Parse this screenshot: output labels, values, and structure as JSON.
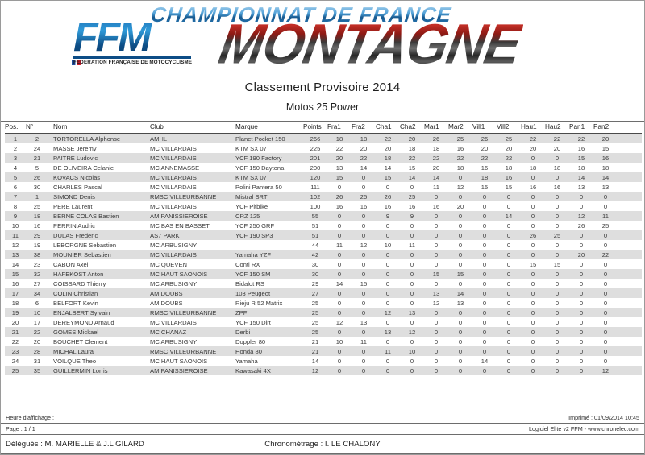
{
  "masthead": {
    "championship_text": "CHAMPIONNAT DE FRANCE",
    "event_text": "MONTAGNE",
    "federation_logo_letters": "FFM",
    "federation_name": "FEDERATION FRANÇAISE DE MOTOCYCLISME",
    "colors": {
      "ffm_blue": "#0d4d86",
      "montagne_red": "#a81c16",
      "montagne_dark": "#262626",
      "champ_blue": "#2f86c4"
    }
  },
  "document": {
    "title": "Classement Provisoire 2014",
    "subtitle": "Motos 25 Power"
  },
  "table": {
    "columns": [
      "Pos.",
      "N°",
      "Nom",
      "Club",
      "Marque",
      "Points",
      "Fra1",
      "Fra2",
      "Cha1",
      "Cha2",
      "Mar1",
      "Mar2",
      "Vill1",
      "Vill2",
      "Hau1",
      "Hau2",
      "Pan1",
      "Pan2"
    ],
    "rows": [
      {
        "pos": "1",
        "num": "2",
        "nom": "TORTORELLA Alphonse",
        "club": "AMHL",
        "marque": "Planet Pocket 150",
        "points": "266",
        "legs": [
          "18",
          "18",
          "22",
          "20",
          "26",
          "25",
          "26",
          "25",
          "22",
          "22",
          "22",
          "20"
        ]
      },
      {
        "pos": "2",
        "num": "24",
        "nom": "MASSE Jeremy",
        "club": "MC VILLARDAIS",
        "marque": "KTM SX 07",
        "points": "225",
        "legs": [
          "22",
          "20",
          "20",
          "18",
          "18",
          "16",
          "20",
          "20",
          "20",
          "20",
          "16",
          "15"
        ]
      },
      {
        "pos": "3",
        "num": "21",
        "nom": "PAITRE Ludovic",
        "club": "MC VILLARDAIS",
        "marque": "YCF 190 Factory",
        "points": "201",
        "legs": [
          "20",
          "22",
          "18",
          "22",
          "22",
          "22",
          "22",
          "22",
          "0",
          "0",
          "15",
          "16"
        ]
      },
      {
        "pos": "4",
        "num": "5",
        "nom": "DE OLIVEIRA Celanie",
        "club": "MC ANNEMASSE",
        "marque": "YCF 150 Daytona",
        "points": "200",
        "legs": [
          "13",
          "14",
          "14",
          "15",
          "20",
          "18",
          "16",
          "18",
          "18",
          "18",
          "18",
          "18"
        ]
      },
      {
        "pos": "5",
        "num": "26",
        "nom": "KOVACS Nicolas",
        "club": "MC VILLARDAIS",
        "marque": "KTM SX 07",
        "points": "120",
        "legs": [
          "15",
          "0",
          "15",
          "14",
          "14",
          "0",
          "18",
          "16",
          "0",
          "0",
          "14",
          "14"
        ]
      },
      {
        "pos": "6",
        "num": "30",
        "nom": "CHARLES Pascal",
        "club": "MC VILLARDAIS",
        "marque": "Polini Pantera 50",
        "points": "111",
        "legs": [
          "0",
          "0",
          "0",
          "0",
          "11",
          "12",
          "15",
          "15",
          "16",
          "16",
          "13",
          "13"
        ]
      },
      {
        "pos": "7",
        "num": "1",
        "nom": "SIMOND Denis",
        "club": "RMSC VILLEURBANNE",
        "marque": "Mistral SRT",
        "points": "102",
        "legs": [
          "26",
          "25",
          "26",
          "25",
          "0",
          "0",
          "0",
          "0",
          "0",
          "0",
          "0",
          "0"
        ]
      },
      {
        "pos": "8",
        "num": "25",
        "nom": "PERE Laurent",
        "club": "MC VILLARDAIS",
        "marque": "YCF Pitbike",
        "points": "100",
        "legs": [
          "16",
          "16",
          "16",
          "16",
          "16",
          "20",
          "0",
          "0",
          "0",
          "0",
          "0",
          "0"
        ]
      },
      {
        "pos": "9",
        "num": "18",
        "nom": "BERNE COLAS Bastien",
        "club": "AM PANISSIEROISE",
        "marque": "CRZ 125",
        "points": "55",
        "legs": [
          "0",
          "0",
          "9",
          "9",
          "0",
          "0",
          "0",
          "14",
          "0",
          "0",
          "12",
          "11"
        ]
      },
      {
        "pos": "10",
        "num": "16",
        "nom": "PERRIN Audric",
        "club": "MC BAS EN BASSET",
        "marque": "YCF 250 GRF",
        "points": "51",
        "legs": [
          "0",
          "0",
          "0",
          "0",
          "0",
          "0",
          "0",
          "0",
          "0",
          "0",
          "26",
          "25"
        ]
      },
      {
        "pos": "11",
        "num": "29",
        "nom": "DULAS Frederic",
        "club": "AS7 PARK",
        "marque": "YCF 190 SP3",
        "points": "51",
        "legs": [
          "0",
          "0",
          "0",
          "0",
          "0",
          "0",
          "0",
          "0",
          "26",
          "25",
          "0",
          "0"
        ]
      },
      {
        "pos": "12",
        "num": "19",
        "nom": "LEBORGNE Sebastien",
        "club": "MC ARBUSIGNY",
        "marque": "",
        "points": "44",
        "legs": [
          "11",
          "12",
          "10",
          "11",
          "0",
          "0",
          "0",
          "0",
          "0",
          "0",
          "0",
          "0"
        ]
      },
      {
        "pos": "13",
        "num": "38",
        "nom": "MOUNIER Sebastien",
        "club": "MC VILLARDAIS",
        "marque": "Yamaha YZF",
        "points": "42",
        "legs": [
          "0",
          "0",
          "0",
          "0",
          "0",
          "0",
          "0",
          "0",
          "0",
          "0",
          "20",
          "22"
        ]
      },
      {
        "pos": "14",
        "num": "23",
        "nom": "CABON Axel",
        "club": "MC QUEVEN",
        "marque": "Conti RX",
        "points": "30",
        "legs": [
          "0",
          "0",
          "0",
          "0",
          "0",
          "0",
          "0",
          "0",
          "15",
          "15",
          "0",
          "0"
        ]
      },
      {
        "pos": "15",
        "num": "32",
        "nom": "HAFEKOST Anton",
        "club": "MC HAUT SAONOIS",
        "marque": "YCF 150 SM",
        "points": "30",
        "legs": [
          "0",
          "0",
          "0",
          "0",
          "15",
          "15",
          "0",
          "0",
          "0",
          "0",
          "0",
          "0"
        ]
      },
      {
        "pos": "16",
        "num": "27",
        "nom": "COISSARD Thierry",
        "club": "MC ARBUSIGNY",
        "marque": "Bidalot RS",
        "points": "29",
        "legs": [
          "14",
          "15",
          "0",
          "0",
          "0",
          "0",
          "0",
          "0",
          "0",
          "0",
          "0",
          "0"
        ]
      },
      {
        "pos": "17",
        "num": "34",
        "nom": "COLIN Christian",
        "club": "AM DOUBS",
        "marque": "103 Peugeot",
        "points": "27",
        "legs": [
          "0",
          "0",
          "0",
          "0",
          "13",
          "14",
          "0",
          "0",
          "0",
          "0",
          "0",
          "0"
        ]
      },
      {
        "pos": "18",
        "num": "6",
        "nom": "BELFORT Kevin",
        "club": "AM DOUBS",
        "marque": "Rieju R 52 Matrix",
        "points": "25",
        "legs": [
          "0",
          "0",
          "0",
          "0",
          "12",
          "13",
          "0",
          "0",
          "0",
          "0",
          "0",
          "0"
        ]
      },
      {
        "pos": "19",
        "num": "10",
        "nom": "ENJALBERT Sylvain",
        "club": "RMSC VILLEURBANNE",
        "marque": "ZPF",
        "points": "25",
        "legs": [
          "0",
          "0",
          "12",
          "13",
          "0",
          "0",
          "0",
          "0",
          "0",
          "0",
          "0",
          "0"
        ]
      },
      {
        "pos": "20",
        "num": "17",
        "nom": "DEREYMOND Arnaud",
        "club": "MC VILLARDAIS",
        "marque": "YCF 150 Dirt",
        "points": "25",
        "legs": [
          "12",
          "13",
          "0",
          "0",
          "0",
          "0",
          "0",
          "0",
          "0",
          "0",
          "0",
          "0"
        ]
      },
      {
        "pos": "21",
        "num": "22",
        "nom": "GOMES Mickael",
        "club": "MC CHANAZ",
        "marque": "Derbi",
        "points": "25",
        "legs": [
          "0",
          "0",
          "13",
          "12",
          "0",
          "0",
          "0",
          "0",
          "0",
          "0",
          "0",
          "0"
        ]
      },
      {
        "pos": "22",
        "num": "20",
        "nom": "BOUCHET Clement",
        "club": "MC ARBUSIGNY",
        "marque": "Doppler 80",
        "points": "21",
        "legs": [
          "10",
          "11",
          "0",
          "0",
          "0",
          "0",
          "0",
          "0",
          "0",
          "0",
          "0",
          "0"
        ]
      },
      {
        "pos": "23",
        "num": "28",
        "nom": "MICHAL Laura",
        "club": "RMSC VILLEURBANNE",
        "marque": "Honda 80",
        "points": "21",
        "legs": [
          "0",
          "0",
          "11",
          "10",
          "0",
          "0",
          "0",
          "0",
          "0",
          "0",
          "0",
          "0"
        ]
      },
      {
        "pos": "24",
        "num": "31",
        "nom": "VOILQUE Theo",
        "club": "MC HAUT SAONOIS",
        "marque": "Yamaha",
        "points": "14",
        "legs": [
          "0",
          "0",
          "0",
          "0",
          "0",
          "0",
          "14",
          "0",
          "0",
          "0",
          "0",
          "0"
        ]
      },
      {
        "pos": "25",
        "num": "35",
        "nom": "GUILLERMIN Lorris",
        "club": "AM PANISSIEROISE",
        "marque": "Kawasaki 4X",
        "points": "12",
        "legs": [
          "0",
          "0",
          "0",
          "0",
          "0",
          "0",
          "0",
          "0",
          "0",
          "0",
          "0",
          "12"
        ]
      }
    ]
  },
  "footer": {
    "display_time_label": "Heure d'affichage :",
    "printed": "Imprimé : 01/09/2014 10:45",
    "page": "Page : 1 / 1",
    "software": "Logiciel Elite v2 FFM - www.chronelec.com",
    "delegates": "Délégués : M. MARIELLE & J.L GILARD",
    "timing": "Chronométrage : I. LE CHALONY"
  }
}
